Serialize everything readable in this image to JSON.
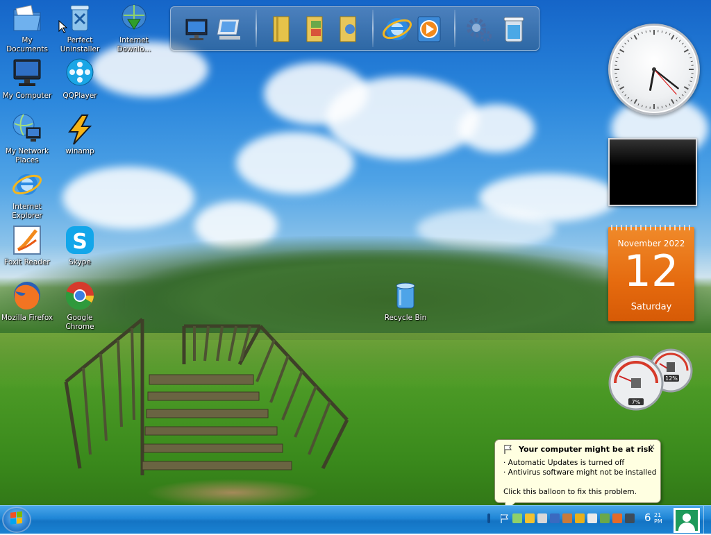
{
  "desktop": {
    "icons": [
      {
        "label": "My Documents",
        "icon": "folder-documents-icon"
      },
      {
        "label": "Perfect\nUninstaller",
        "icon": "uninstaller-icon"
      },
      {
        "label": "Internet\nDownlo...",
        "icon": "download-manager-icon"
      },
      {
        "label": "My Computer",
        "icon": "monitor-icon"
      },
      {
        "label": "QQPlayer",
        "icon": "film-reel-icon"
      },
      {
        "label": "My Network\nPlaces",
        "icon": "network-globe-icon"
      },
      {
        "label": "winamp",
        "icon": "winamp-bolt-icon"
      },
      {
        "label": "Internet\nExplorer",
        "icon": "ie-logo-icon"
      },
      {
        "label": "Foxit Reader",
        "icon": "pdf-reader-icon"
      },
      {
        "label": "Skype",
        "icon": "skype-icon"
      },
      {
        "label": "Mozilla Firefox",
        "icon": "firefox-icon"
      },
      {
        "label": "Google Chrome",
        "icon": "chrome-icon"
      },
      {
        "label": "Recycle Bin",
        "icon": "recycle-bin-icon"
      }
    ]
  },
  "dock": {
    "items": [
      "computer-icon",
      "network-icon",
      "folder-icon",
      "documents-icon",
      "pictures-icon",
      "browser-icon",
      "media-player-icon",
      "settings-icon",
      "trash-icon"
    ]
  },
  "gadgets": {
    "clock": {
      "hour": 6,
      "minute": 21,
      "second": 23
    },
    "calendar": {
      "month": "November 2022",
      "day": "12",
      "weekday": "Saturday"
    },
    "meters": {
      "cpu": "7%",
      "memory": "12%"
    }
  },
  "balloon": {
    "title": "Your computer might be at risk",
    "lines": [
      "· Automatic Updates is turned off",
      "· Antivirus software might not be installed",
      "Click this balloon to fix this problem."
    ],
    "close": "×"
  },
  "taskbar": {
    "time": "6",
    "minutes": "21",
    "ampm": "PM"
  },
  "colors": {
    "taskbar": "#1f86d6",
    "calendar": "#e56a0e",
    "balloon": "#ffffe1"
  }
}
